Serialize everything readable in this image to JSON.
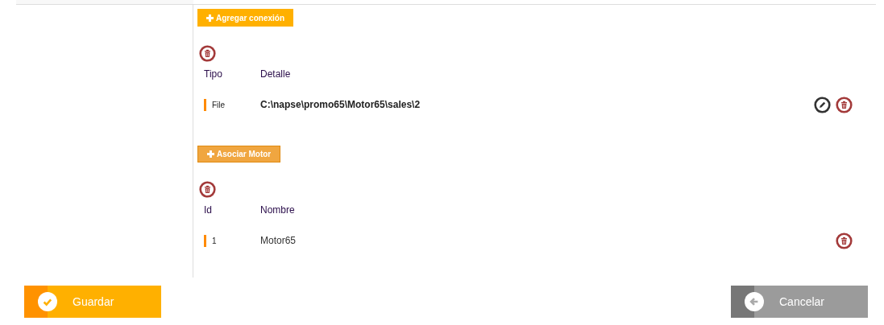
{
  "sections": [
    {
      "add_button": {
        "label": "Agregar conexión",
        "kind": "primary"
      },
      "columns": [
        "Tipo",
        "Detalle"
      ],
      "rows": [
        {
          "cells": [
            "File",
            "C:\\napse\\promo65\\Motor65\\sales\\2"
          ],
          "editable": true
        }
      ]
    },
    {
      "add_button": {
        "label": "Asociar Motor",
        "kind": "secondary"
      },
      "columns": [
        "Id",
        "Nombre"
      ],
      "rows": [
        {
          "cells": [
            "1",
            "Motor65"
          ],
          "editable": false
        }
      ]
    }
  ],
  "footer": [
    {
      "label": "Guardar",
      "kind": "save"
    },
    {
      "label": "Cancelar",
      "kind": "cancel"
    }
  ]
}
